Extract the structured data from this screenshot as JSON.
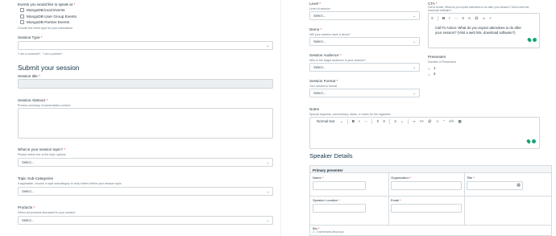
{
  "left": {
    "events_label": "Events you would like to speak at",
    "events": [
      "MongoDB.local Events",
      "MongoDB User Group Events",
      "MongoDB Partner Events"
    ],
    "events_help": "Choose the event type for your submission",
    "session_type_label": "Session Type",
    "session_type_help": "\"I am a customer\", \"I am a partner\"...",
    "submit_heading": "Submit your session",
    "session_title_label": "Session title",
    "session_abstract_label": "Session Abstract",
    "session_abstract_help": "Precise summary of presentation content",
    "topic_label": "What is your session topic?",
    "topic_help": "Please select one of the topic options",
    "topic_value": "Select...",
    "subcat_label": "Topic Sub-Categories",
    "subcat_help": "If applicable, choose a topic subcategory to help further define your session topic",
    "subcat_value": "Select...",
    "products_label": "Products",
    "products_help": "Select all products discussed in your session",
    "products_value": "Select..."
  },
  "right": {
    "level_label": "Level",
    "level_help": "Level of session",
    "level_value": "Select...",
    "demo_label": "Demo",
    "demo_help": "Will your session have a demo?",
    "demo_value": "Select...",
    "audience_label": "Session Audience",
    "audience_help": "Who is the target audience of your session?",
    "audience_value": "Select...",
    "format_label": "Session Format",
    "format_help": "Your session's format",
    "format_value": "Select...",
    "cta_label": "CTA",
    "cta_help": "Call to Action: What do you expect attendees to do after your session? Visit a web link, download software?",
    "cta_text": "Call To Action: What do you expect attendees to do after your session? (Visit a web link, download software?)",
    "presenters_label": "Presenters",
    "presenters_help": "Number of Presenters",
    "presenter_options": [
      "1",
      "2"
    ],
    "notes_label": "Notes",
    "notes_help": "Special requests, commentary, ideas, or notes for the organizer",
    "notes_style": "Normal text",
    "speaker_heading": "Speaker Details",
    "primary_presenter": "Primary presenter",
    "name_label": "Name",
    "org_label": "Organization",
    "title_label": "Title",
    "location_label": "Speaker Location",
    "email_label": "Email",
    "bio_label": "Bio",
    "bio_help": "2 - 3 sentences about you"
  },
  "icons": {
    "dropdown": "chevron-down-icon",
    "calendar": "calendar-icon",
    "grammarly": "grammarly-icon"
  },
  "colors": {
    "required": "#d63031",
    "heading": "#17374a",
    "grammarly": "#14a37f"
  }
}
